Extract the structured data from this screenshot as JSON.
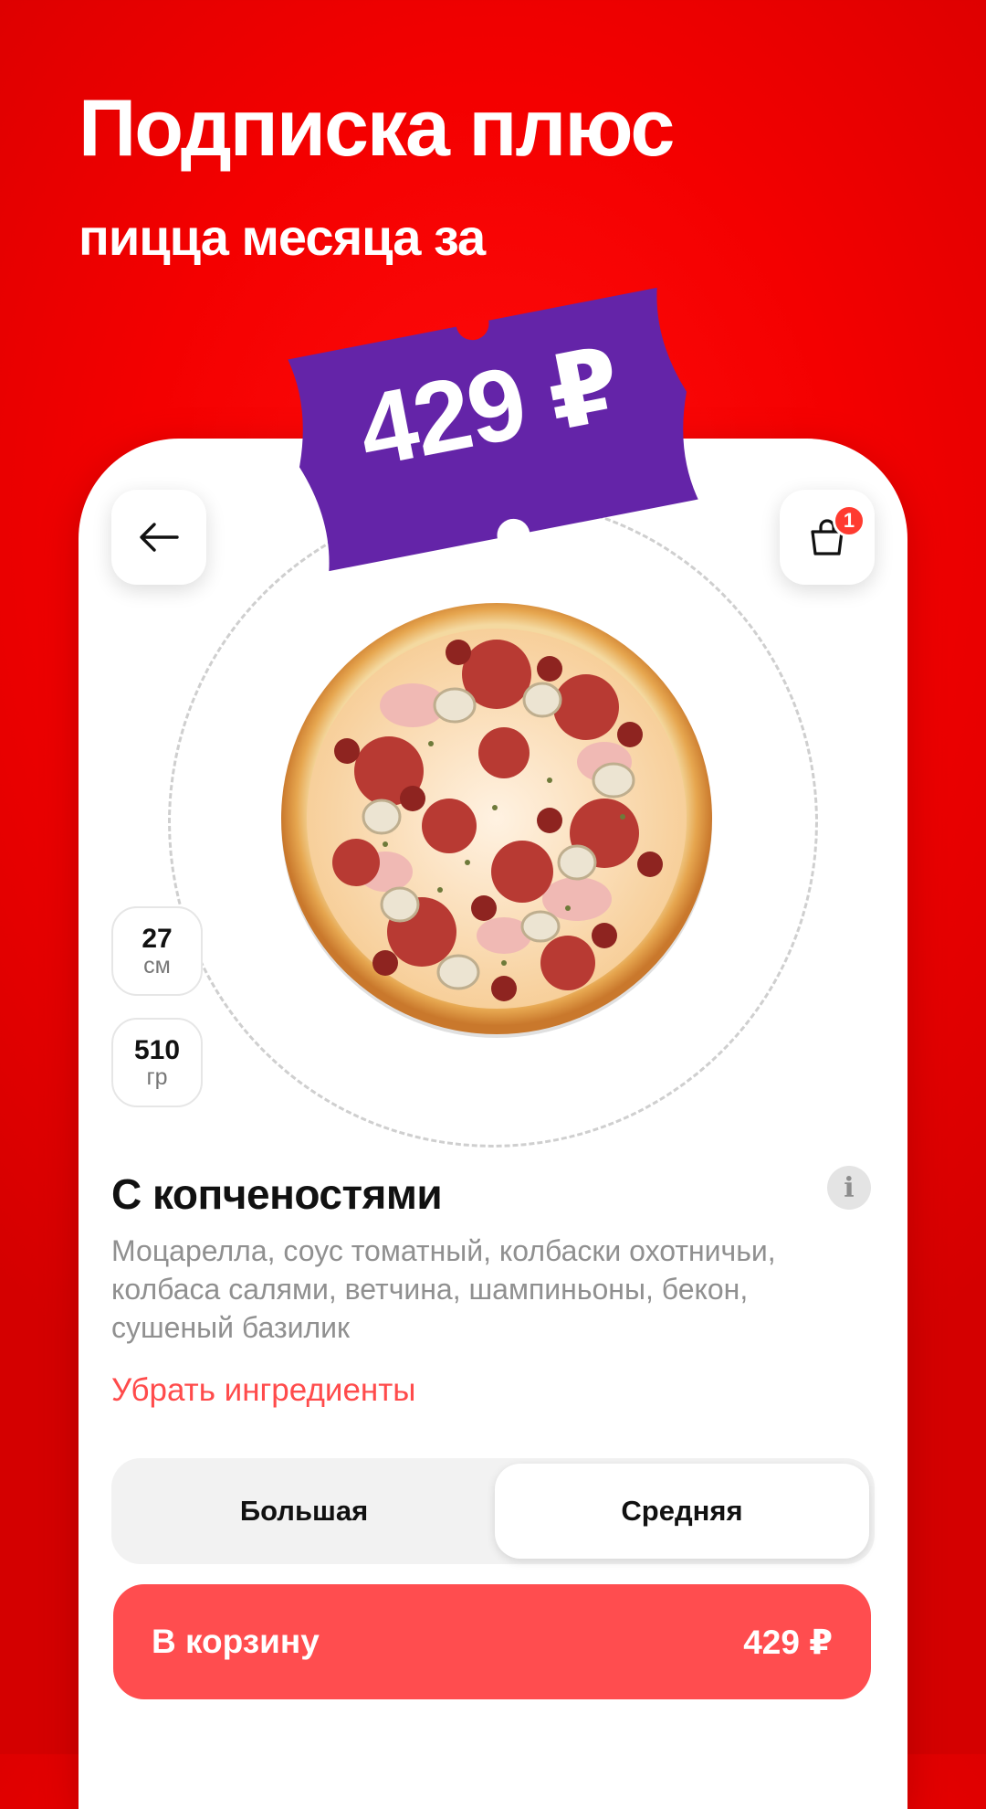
{
  "promo": {
    "headline": "Подписка плюс",
    "subline": "пицца месяца за",
    "price_tag": "429 ₽"
  },
  "colors": {
    "background": "#f40000",
    "accent": "#ff4d4f",
    "tag": "#6424a8",
    "badge": "#ff3b30"
  },
  "nav": {
    "back_icon": "arrow-left-icon",
    "cart_icon": "shopping-bag-icon",
    "cart_count": "1"
  },
  "product": {
    "size_value": "27",
    "size_unit": "см",
    "weight_value": "510",
    "weight_unit": "гр",
    "title": "С копченостями",
    "info_icon": "i",
    "description": "Моцарелла, соус томатный, колбаски охотничьи, колбаса салями, ветчина, шампиньоны, бекон, сушеный базилик",
    "remove_link": "Убрать ингредиенты"
  },
  "size_options": {
    "left": "Большая",
    "right": "Средняя",
    "selected": "Средняя"
  },
  "cta": {
    "label": "В корзину",
    "price": "429 ₽"
  }
}
